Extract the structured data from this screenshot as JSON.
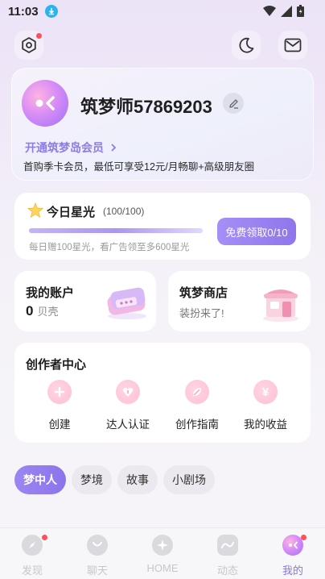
{
  "status_bar": {
    "time": "11:03"
  },
  "header": {
    "settings_icon": "gear-icon",
    "moon_icon": "moon-icon",
    "mail_icon": "mail-icon"
  },
  "profile": {
    "username": "筑梦师57869203",
    "vip_link": "开通筑梦岛会员",
    "vip_desc": "首购季卡会员，最低可享受12元/月畅聊+高级朋友圈"
  },
  "stars": {
    "title": "今日星光",
    "count": "(100/100)",
    "progress": 1.0,
    "tip": "每日赠100星光，看广告领至多600星光",
    "claim_label": "免费领取0/10"
  },
  "account": {
    "title": "我的账户",
    "balance": "0",
    "unit": "贝壳"
  },
  "shop": {
    "title": "筑梦商店",
    "subtitle": "装扮来了!"
  },
  "creator": {
    "title": "创作者中心",
    "items": [
      {
        "label": "创建",
        "icon": "plus-icon"
      },
      {
        "label": "达人认证",
        "icon": "heart-badge-icon"
      },
      {
        "label": "创作指南",
        "icon": "leaf-icon"
      },
      {
        "label": "我的收益",
        "icon": "yen-icon"
      }
    ]
  },
  "tabs": [
    "梦中人",
    "梦境",
    "故事",
    "小剧场"
  ],
  "bottom_nav": [
    {
      "label": "发现",
      "icon": "compass-icon"
    },
    {
      "label": "聊天",
      "icon": "chat-icon"
    },
    {
      "label": "HOME",
      "icon": "home-star-icon"
    },
    {
      "label": "动态",
      "icon": "feed-icon"
    },
    {
      "label": "我的",
      "icon": "profile-icon"
    }
  ],
  "colors": {
    "accent": "#8d7ce8",
    "badge": "#ff4f5e",
    "claim": "#9a82f1"
  }
}
